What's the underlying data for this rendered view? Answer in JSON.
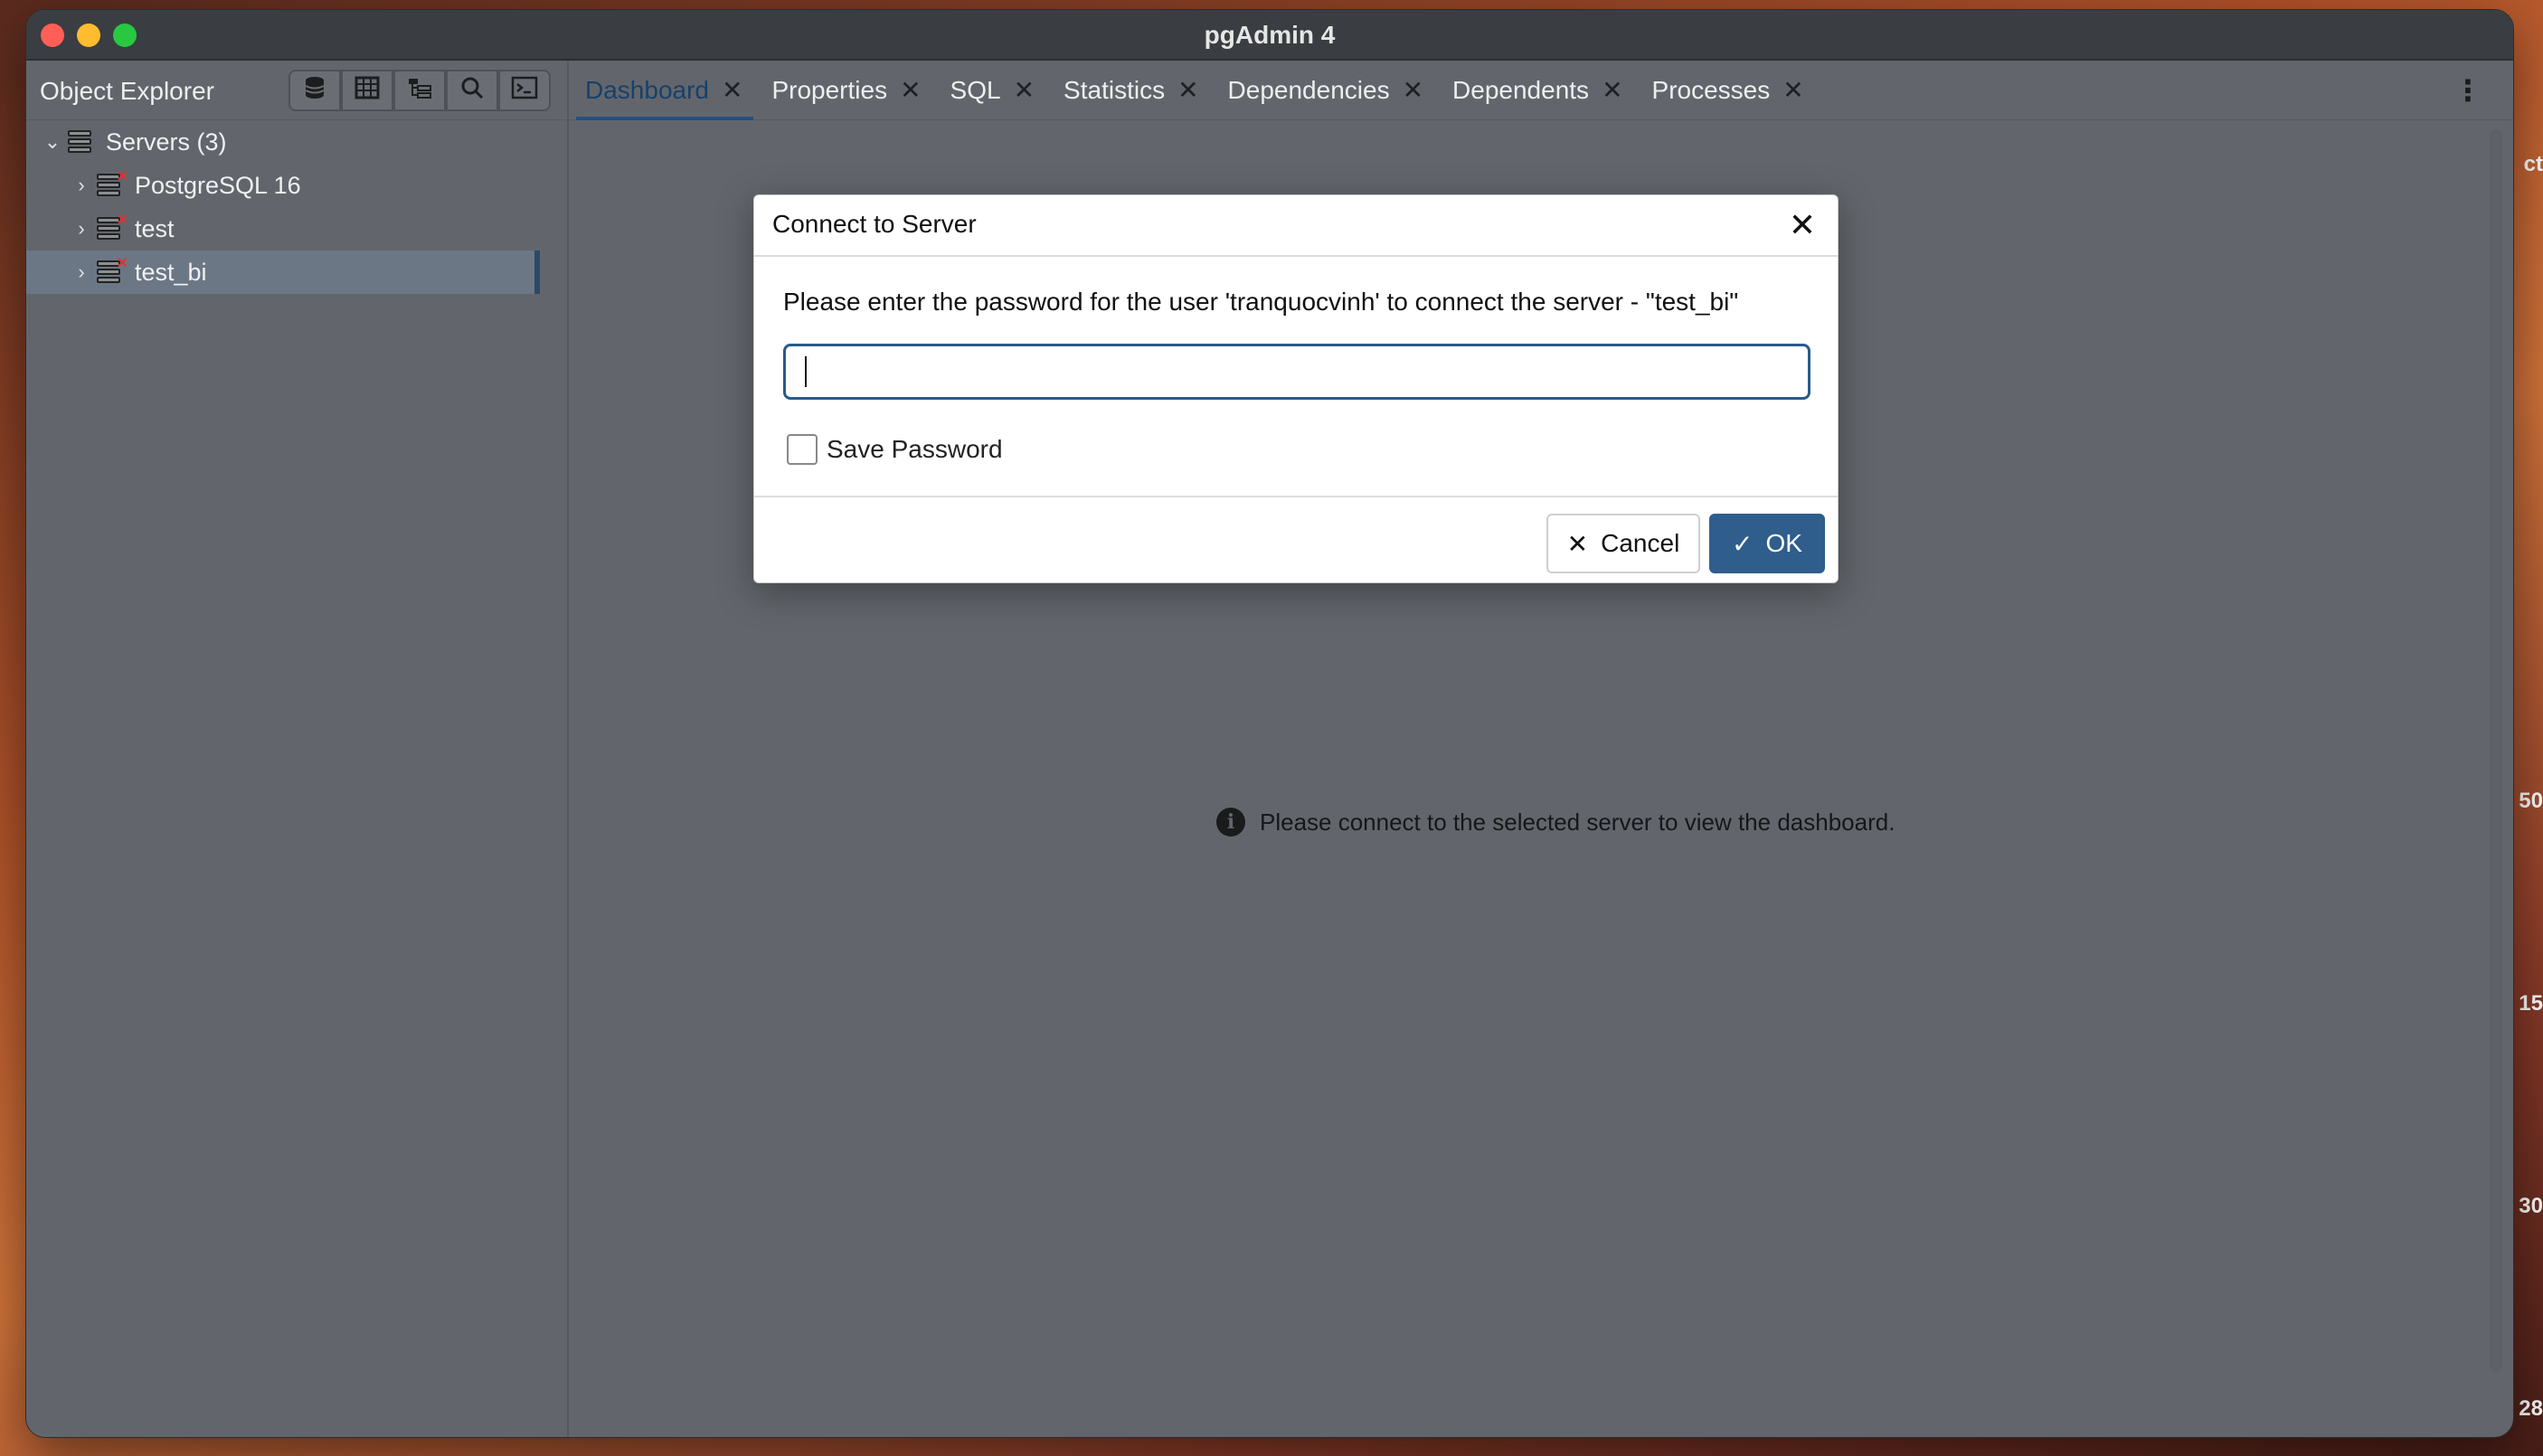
{
  "window": {
    "title": "pgAdmin 4"
  },
  "desktop_edge": [
    "ct",
    "50",
    "15",
    "30",
    "28"
  ],
  "explorer": {
    "title": "Object Explorer",
    "tools": [
      {
        "name": "database-icon",
        "glyph": "⛁"
      },
      {
        "name": "table-icon",
        "glyph": "▦"
      },
      {
        "name": "tree-icon",
        "glyph": "☷"
      },
      {
        "name": "search-icon",
        "glyph": "⌕"
      },
      {
        "name": "terminal-icon",
        "glyph": ">_"
      }
    ],
    "tree": {
      "root": {
        "label": "Servers (3)"
      },
      "servers": [
        {
          "label": "PostgreSQL 16"
        },
        {
          "label": "test"
        },
        {
          "label": "test_bi"
        }
      ]
    }
  },
  "tabs": [
    {
      "label": "Dashboard"
    },
    {
      "label": "Properties"
    },
    {
      "label": "SQL"
    },
    {
      "label": "Statistics"
    },
    {
      "label": "Dependencies"
    },
    {
      "label": "Dependents"
    },
    {
      "label": "Processes"
    }
  ],
  "dashboard": {
    "message": "Please connect to the selected server to view the dashboard."
  },
  "dialog": {
    "title": "Connect to Server",
    "message": "Please enter the password for the user 'tranquocvinh' to connect the server - \"test_bi\"",
    "password_value": "",
    "save_password_label": "Save Password",
    "cancel_label": "Cancel",
    "ok_label": "OK"
  },
  "colors": {
    "accent": "#2f5d8c",
    "tab_active": "#17416a",
    "error_x": "#dd3333"
  }
}
